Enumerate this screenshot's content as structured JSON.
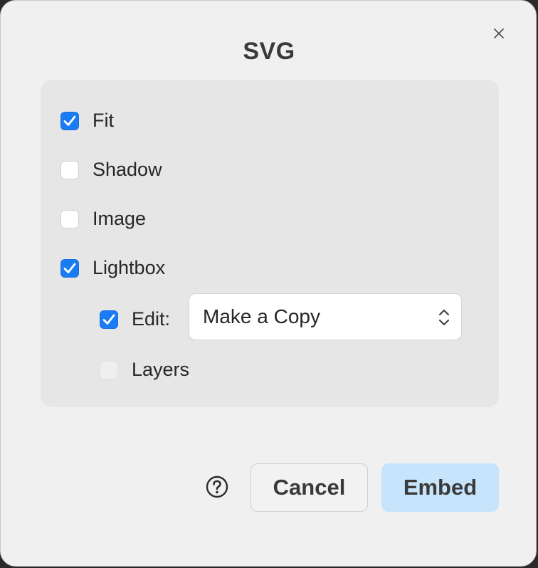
{
  "dialog": {
    "title": "SVG",
    "close_icon": "close-icon"
  },
  "options": {
    "fit": {
      "label": "Fit",
      "checked": true
    },
    "shadow": {
      "label": "Shadow",
      "checked": false
    },
    "image": {
      "label": "Image",
      "checked": false
    },
    "lightbox": {
      "label": "Lightbox",
      "checked": true
    },
    "edit": {
      "label": "Edit:",
      "checked": true
    },
    "layers": {
      "label": "Layers",
      "checked": false,
      "disabled": true
    }
  },
  "edit_select": {
    "value": "Make a Copy",
    "icon": "chevron-up-down-icon"
  },
  "footer": {
    "help_icon": "question-circle-icon",
    "cancel_label": "Cancel",
    "embed_label": "Embed"
  },
  "colors": {
    "accent": "#1a7cf5",
    "embed_button": "#c6e4fb",
    "panel": "#e6e6e6",
    "dialog": "#f0f0f0"
  }
}
